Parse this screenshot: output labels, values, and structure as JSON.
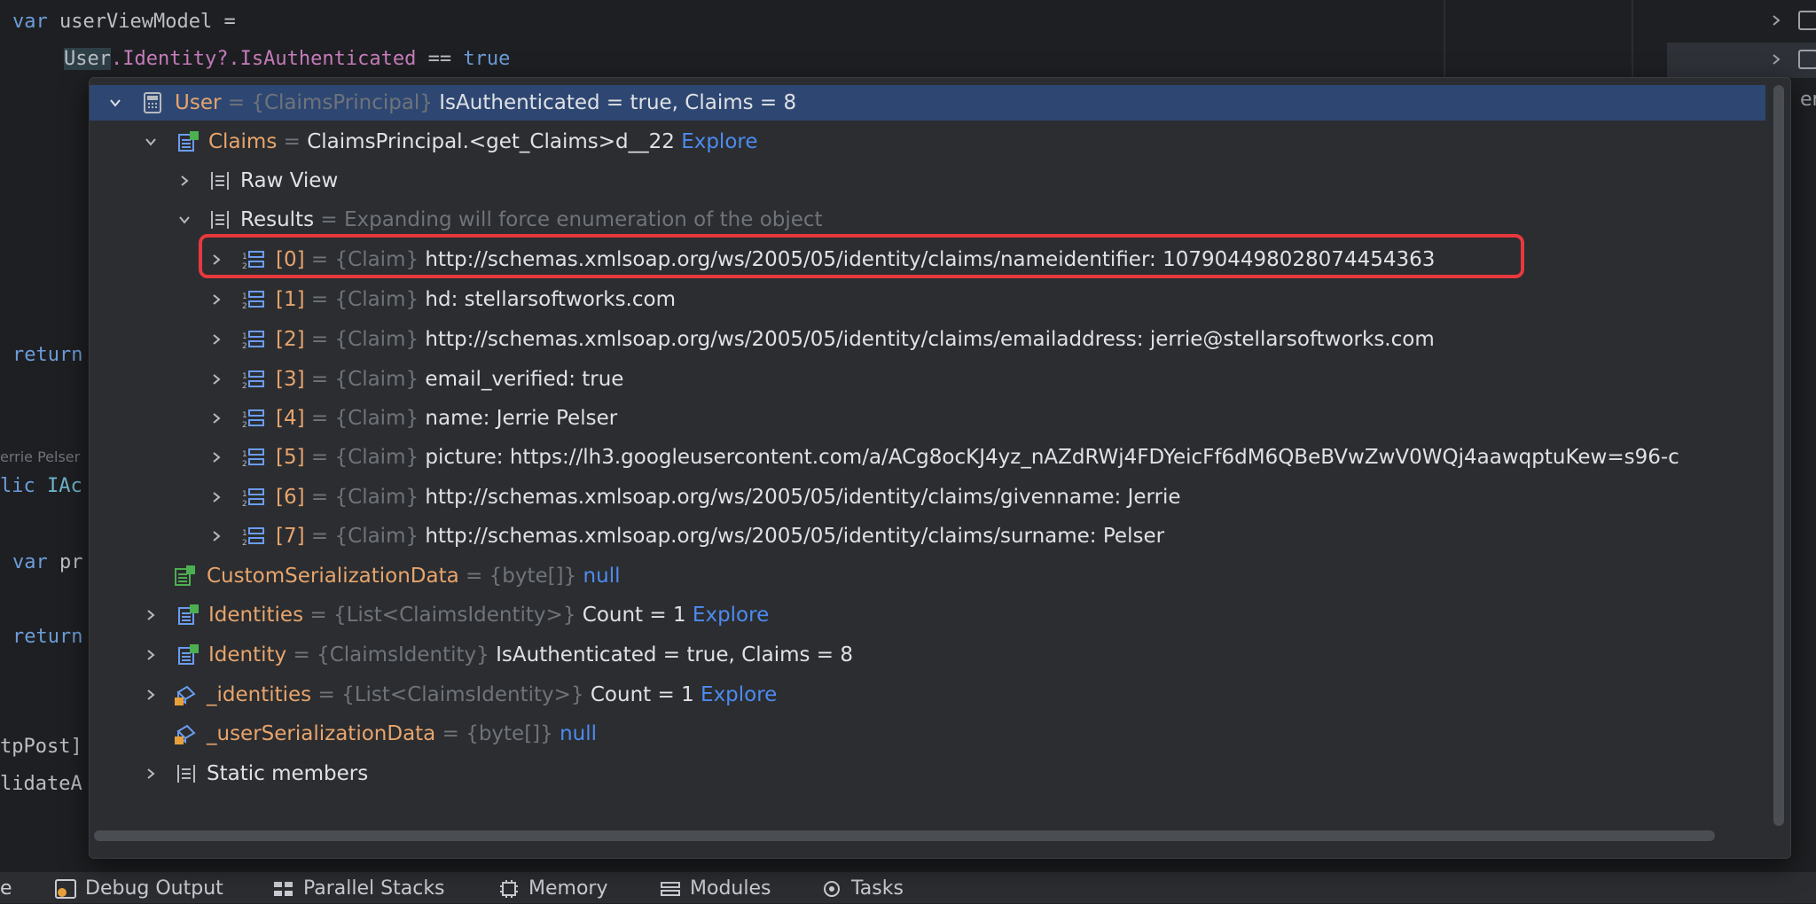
{
  "editor": {
    "line1": [
      "var",
      "userViewModel",
      "="
    ],
    "line2": [
      "User",
      ".Identity?.IsAuthenticated",
      "==",
      "true"
    ],
    "return1": "return",
    "author": "errie Pelser",
    "public_line": [
      "lic",
      "IAc"
    ],
    "var_line": [
      "var",
      "pr"
    ],
    "return2": "return",
    "attr1": "tpPost]",
    "attr2": "lidateA",
    "right_clip": "erv"
  },
  "tree": {
    "user": {
      "name": "User",
      "type": "{ClaimsPrincipal}",
      "value": "IsAuthenticated = true, Claims = 8"
    },
    "claims": {
      "name": "Claims",
      "value": "ClaimsPrincipal.<get_Claims>d__22",
      "link": "Explore"
    },
    "raw_view": {
      "label": "Raw View"
    },
    "results": {
      "label": "Results",
      "hint": "Expanding will force enumeration of the object"
    },
    "claim_items": [
      {
        "index": "[0]",
        "type": "{Claim}",
        "value": "http://schemas.xmlsoap.org/ws/2005/05/identity/claims/nameidentifier: 107904498028074454363"
      },
      {
        "index": "[1]",
        "type": "{Claim}",
        "value": "hd: stellarsoftworks.com"
      },
      {
        "index": "[2]",
        "type": "{Claim}",
        "value": "http://schemas.xmlsoap.org/ws/2005/05/identity/claims/emailaddress: jerrie@stellarsoftworks.com"
      },
      {
        "index": "[3]",
        "type": "{Claim}",
        "value": "email_verified: true"
      },
      {
        "index": "[4]",
        "type": "{Claim}",
        "value": "name: Jerrie Pelser"
      },
      {
        "index": "[5]",
        "type": "{Claim}",
        "value": "picture: https://lh3.googleusercontent.com/a/ACg8ocKJ4yz_nAZdRWj4FDYeicFf6dM6QBeBVwZwV0WQj4aawqptuKew=s96-c"
      },
      {
        "index": "[6]",
        "type": "{Claim}",
        "value": "http://schemas.xmlsoap.org/ws/2005/05/identity/claims/givenname: Jerrie"
      },
      {
        "index": "[7]",
        "type": "{Claim}",
        "value": "http://schemas.xmlsoap.org/ws/2005/05/identity/claims/surname: Pelser"
      }
    ],
    "custom_serialization": {
      "name": "CustomSerializationData",
      "type": "{byte[]}",
      "value": "null"
    },
    "identities": {
      "name": "Identities",
      "type": "{List<ClaimsIdentity>}",
      "value": "Count = 1",
      "link": "Explore"
    },
    "identity": {
      "name": "Identity",
      "type": "{ClaimsIdentity}",
      "value": "IsAuthenticated = true, Claims = 8"
    },
    "_identities": {
      "name": "_identities",
      "type": "{List<ClaimsIdentity>}",
      "value": "Count = 1",
      "link": "Explore"
    },
    "_user_serialization": {
      "name": "_userSerializationData",
      "type": "{byte[]}",
      "value": "null"
    },
    "static_members": {
      "label": "Static members"
    },
    "equals": "="
  },
  "bottom_tabs": {
    "first_clip": "e",
    "debug_output": "Debug Output",
    "parallel_stacks": "Parallel Stacks",
    "memory": "Memory",
    "modules": "Modules",
    "tasks": "Tasks"
  },
  "colors": {
    "selection": "#2e4772",
    "highlight_border": "#e6393d",
    "name_orange": "#e8a46c",
    "link_blue": "#4d8bf0"
  }
}
